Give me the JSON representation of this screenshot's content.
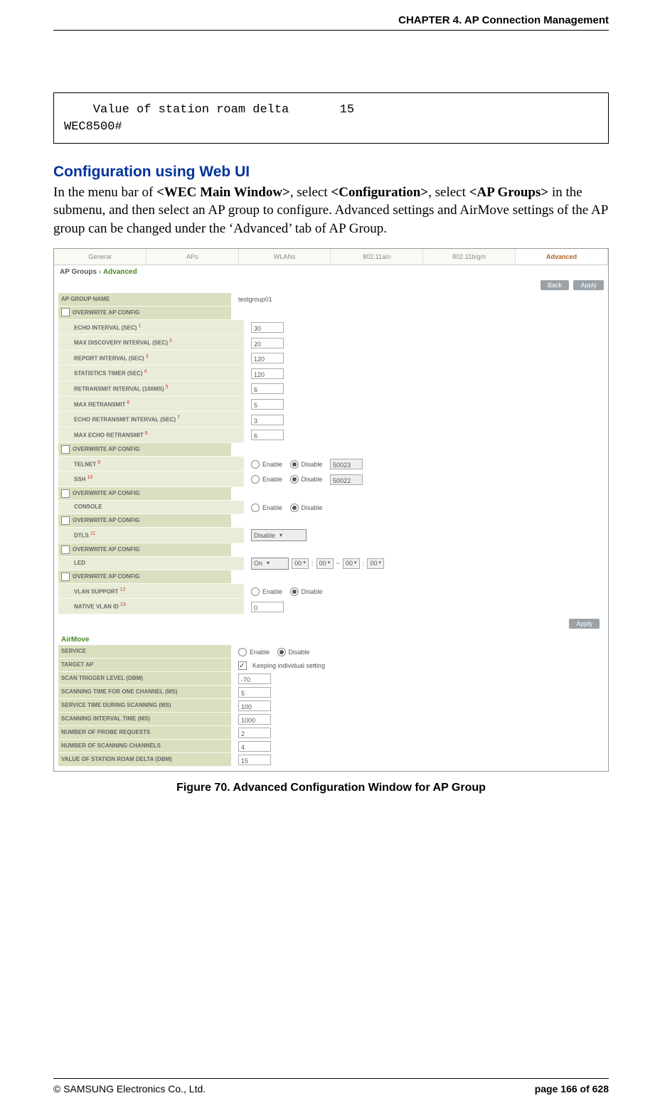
{
  "header": {
    "chapter": "CHAPTER 4. AP Connection Management"
  },
  "code": {
    "line1": "    Value of station roam delta       15",
    "line2": "WEC8500#"
  },
  "sect_title": "Configuration using Web UI",
  "body_html_parts": {
    "p1a": "In the menu bar of ",
    "b1": "<WEC Main Window>",
    "p1b": ", select ",
    "b2": "<Configuration>",
    "p1c": ", select ",
    "b3": "<AP Groups>",
    "p1d": " in the submenu, and then select an AP group to configure. Advanced settings and AirMove settings of the AP group can be changed under the ‘Advanced’ tab of AP Group."
  },
  "tabs": [
    "General",
    "APs",
    "WLANs",
    "802.11a/n",
    "802.11b/g/n",
    "Advanced"
  ],
  "crumb": {
    "root": "AP Groups",
    "sep": "  ›  ",
    "leaf": "Advanced"
  },
  "btns": {
    "back": "Back",
    "apply": "Apply"
  },
  "radios": {
    "enable": "Enable",
    "disable": "Disable"
  },
  "grp": {
    "name_lab": "AP GROUP NAME",
    "name_val": "testgroup01",
    "ov": "OVERWRITE AP CONFIG",
    "echo_int": "ECHO INTERVAL (SEC)",
    "echo_int_v": "30",
    "max_disc": "MAX DISCOVERY INTERVAL (SEC)",
    "max_disc_v": "20",
    "rep_int": "REPORT INTERVAL (SEC)",
    "rep_int_v": "120",
    "stat_tmr": "STATISTICS TIMER (SEC)",
    "stat_tmr_v": "120",
    "retx": "RETRANSMIT INTERVAL (100MS)",
    "retx_v": "6",
    "max_retx": "MAX RETRANSMIT",
    "max_retx_v": "5",
    "echo_retx": "ECHO RETRANSMIT INTERVAL (SEC)",
    "echo_retx_v": "3",
    "max_echo_retx": "MAX ECHO RETRANSMIT",
    "max_echo_retx_v": "6",
    "telnet": "TELNET",
    "telnet_port": "50023",
    "ssh": "SSH",
    "ssh_port": "50022",
    "console": "CONSOLE",
    "dtls": "DTLS",
    "dtls_v": "Disable",
    "led": "LED",
    "led_v": "On",
    "led_h1": "00",
    "led_m1": "00",
    "led_h2": "00",
    "led_m2": "00",
    "vlan_sup": "VLAN SUPPORT",
    "native_vlan": "NATIVE VLAN ID",
    "native_vlan_v": "0",
    "sup": {
      "1": "1",
      "2": "2",
      "3": "3",
      "4": "4",
      "5": "5",
      "6": "6",
      "7": "7",
      "8": "8",
      "9": "9",
      "10": "10",
      "11": "11",
      "12": "12",
      "13": "13"
    }
  },
  "airmove": {
    "title": "AirMove",
    "service": "SERVICE",
    "target_ap": "TARGET AP",
    "target_ap_chk": "Keeping individual setting",
    "scan_trig": "SCAN TRIGGER LEVEL (DBM)",
    "scan_trig_v": "-70",
    "scan_one": "SCANNING TIME FOR ONE CHANNEL (MS)",
    "scan_one_v": "5",
    "svc_time": "SERVICE TIME DURING SCANNING (MS)",
    "svc_time_v": "100",
    "scan_int": "SCANNING INTERVAL TIME (MS)",
    "scan_int_v": "1000",
    "probe_req": "NUMBER OF PROBE REQUESTS",
    "probe_req_v": "2",
    "scan_ch": "NUMBER OF SCANNING CHANNELS",
    "scan_ch_v": "4",
    "roam_delta": "VALUE OF STATION ROAM DELTA (DBM)",
    "roam_delta_v": "15"
  },
  "caption": "Figure 70. Advanced Configuration Window for AP Group",
  "footer": {
    "left": "© SAMSUNG Electronics Co., Ltd.",
    "right": "page 166 of 628"
  }
}
